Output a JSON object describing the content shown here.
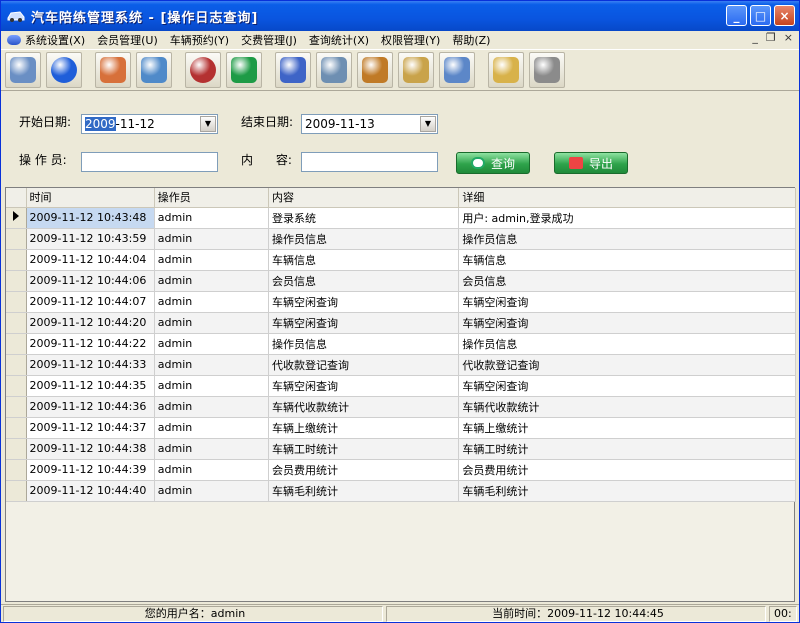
{
  "window": {
    "title": "汽车陪练管理系统 - [操作日志查询]",
    "buttons": [
      "_",
      "□",
      "×"
    ]
  },
  "menu": [
    "系统设置(X)",
    "会员管理(U)",
    "车辆预约(Y)",
    "交费管理(J)",
    "查询统计(X)",
    "权限管理(Y)",
    "帮助(Z)"
  ],
  "mdi_controls": [
    "_",
    "❐",
    "×"
  ],
  "toolbar": [
    "system-icon",
    "globe-icon",
    "users-icon",
    "edit-icon",
    "disc-icon",
    "green-icon",
    "battery-icon",
    "money-icon",
    "briefcase-icon",
    "book-icon",
    "calculator-icon",
    "folder-icon",
    "printer-icon"
  ],
  "toolbar_colors": [
    "#6a8fc4",
    "#1f5ed9",
    "#d7703a",
    "#4f8ac9",
    "#b43131",
    "#1e9b46",
    "#3e64c7",
    "#6e8fb2",
    "#c07a26",
    "#c9a34a",
    "#5c87c8",
    "#d8b24a",
    "#8b8b8b"
  ],
  "filter": {
    "start_label": "开始日期:",
    "start_value_selected": "2009",
    "start_value_rest": "-11-12",
    "end_label": "结束日期:",
    "end_value": "2009-11-13",
    "operator_label": "操 作 员:",
    "operator_value": "",
    "content_label": "内      容:",
    "content_value": "",
    "search_button": "查询",
    "export_button": "导出"
  },
  "grid": {
    "columns": [
      "时间",
      "操作员",
      "内容",
      "详细"
    ],
    "rows": [
      [
        "2009-11-12 10:43:48",
        "admin",
        "登录系统",
        "用户: admin,登录成功"
      ],
      [
        "2009-11-12 10:43:59",
        "admin",
        "操作员信息",
        "操作员信息"
      ],
      [
        "2009-11-12 10:44:04",
        "admin",
        "车辆信息",
        "车辆信息"
      ],
      [
        "2009-11-12 10:44:06",
        "admin",
        "会员信息",
        "会员信息"
      ],
      [
        "2009-11-12 10:44:07",
        "admin",
        "车辆空闲查询",
        "车辆空闲查询"
      ],
      [
        "2009-11-12 10:44:20",
        "admin",
        "车辆空闲查询",
        "车辆空闲查询"
      ],
      [
        "2009-11-12 10:44:22",
        "admin",
        "操作员信息",
        "操作员信息"
      ],
      [
        "2009-11-12 10:44:33",
        "admin",
        "代收款登记查询",
        "代收款登记查询"
      ],
      [
        "2009-11-12 10:44:35",
        "admin",
        "车辆空闲查询",
        "车辆空闲查询"
      ],
      [
        "2009-11-12 10:44:36",
        "admin",
        "车辆代收款统计",
        "车辆代收款统计"
      ],
      [
        "2009-11-12 10:44:37",
        "admin",
        "车辆上缴统计",
        "车辆上缴统计"
      ],
      [
        "2009-11-12 10:44:38",
        "admin",
        "车辆工时统计",
        "车辆工时统计"
      ],
      [
        "2009-11-12 10:44:39",
        "admin",
        "会员费用统计",
        "会员费用统计"
      ],
      [
        "2009-11-12 10:44:40",
        "admin",
        "车辆毛利统计",
        "车辆毛利统计"
      ]
    ]
  },
  "status": {
    "user": "您的用户名：admin",
    "time": "当前时间：2009-11-12 10:44:45",
    "extra": "00:"
  }
}
